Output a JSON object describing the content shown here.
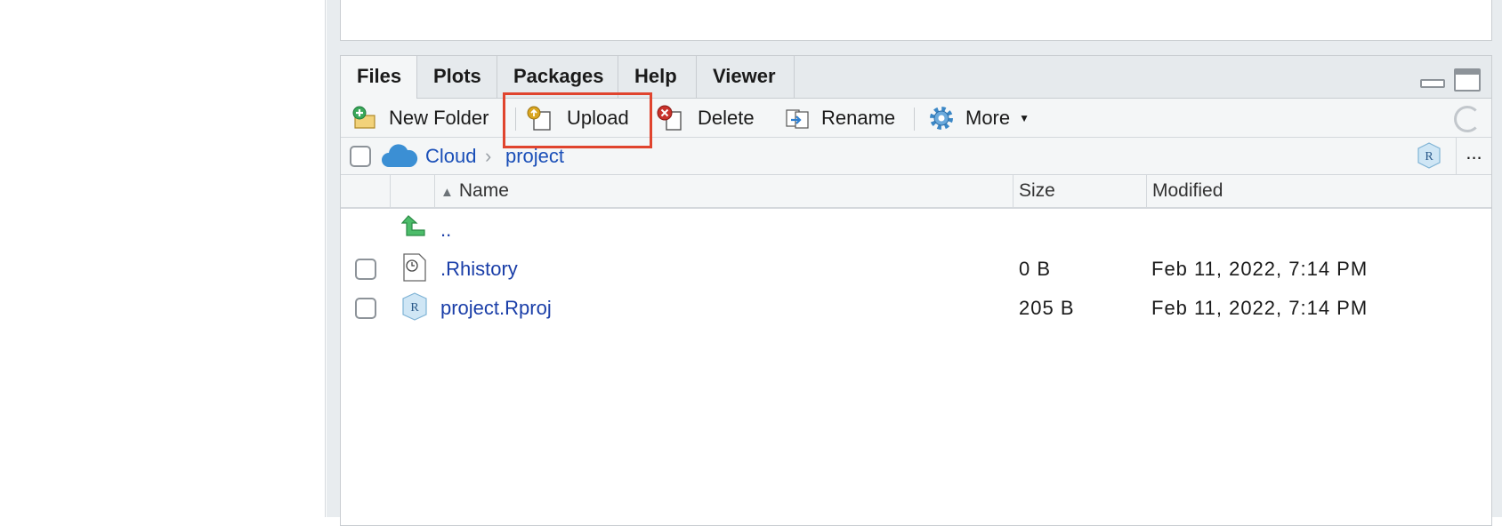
{
  "tabs": [
    "Files",
    "Plots",
    "Packages",
    "Help",
    "Viewer"
  ],
  "toolbar": {
    "new_folder": "New Folder",
    "upload": "Upload",
    "delete": "Delete",
    "rename": "Rename",
    "more": "More"
  },
  "breadcrumb": {
    "root": "Cloud",
    "folder": "project",
    "more": "..."
  },
  "columns": {
    "name": "Name",
    "size": "Size",
    "modified": "Modified"
  },
  "files": {
    "parent": "..",
    "rows": [
      {
        "name": ".Rhistory",
        "size": "0 B",
        "modified": "Feb 11, 2022, 7:14 PM",
        "icon": "history-file-icon"
      },
      {
        "name": "project.Rproj",
        "size": "205 B",
        "modified": "Feb 11, 2022, 7:14 PM",
        "icon": "rproj-file-icon"
      }
    ]
  },
  "colors": {
    "highlight": "#e0442e",
    "link": "#1a3ea8",
    "cloud": "#3b8fd4"
  }
}
